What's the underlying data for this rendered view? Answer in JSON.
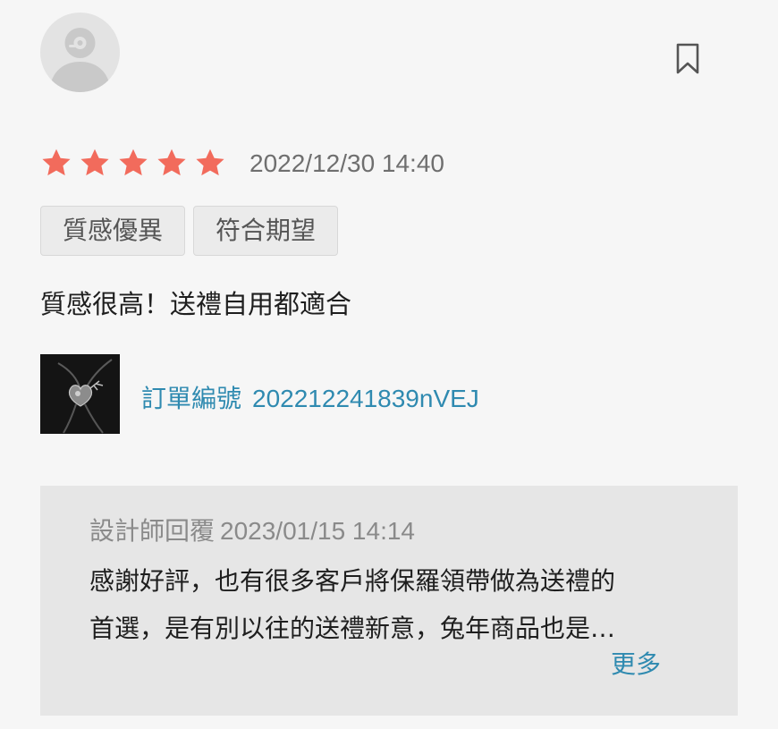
{
  "review": {
    "avatar_icon": "default-user-avatar-icon",
    "bookmark_icon": "bookmark-icon",
    "rating": 5,
    "rating_max": 5,
    "star_color": "#f26b5c",
    "date": "2022/12/30 14:40",
    "tags": [
      "質感優異",
      "符合期望"
    ],
    "text": "質感很高！送禮自用都適合",
    "order_label": "訂單編號",
    "order_number": "202212241839nVEJ"
  },
  "reply": {
    "author": "設計師回覆",
    "date": "2023/01/15 14:14",
    "line1": "感謝好評，也有很多客戶將保羅領帶做為送禮的",
    "line2": "首選，是有別以往的送禮新意，兔年商品也是…",
    "more": "更多"
  },
  "colors": {
    "link": "#2f8ab0",
    "background": "#f6f6f6",
    "reply_background": "#e6e6e6"
  }
}
